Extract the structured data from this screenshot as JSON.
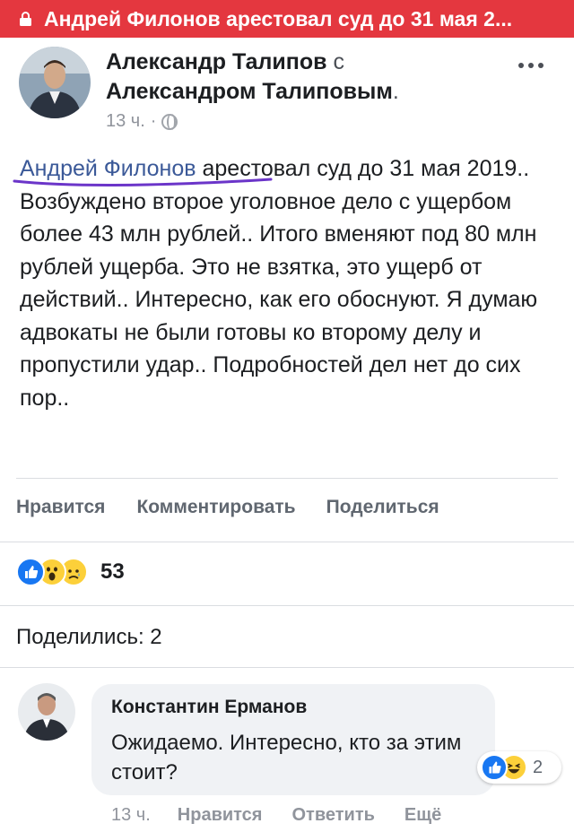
{
  "topbar": {
    "title": "Андрей Филонов арестовал суд до 31 мая 2..."
  },
  "post": {
    "author": "Александр Талипов",
    "with_word": "с",
    "tagged": "Александром Талиповым",
    "time": "13 ч.",
    "meta_dot": "·",
    "mention": "Андрей Филонов",
    "text": " арестовал суд до 31 мая 2019.. Возбуждено второе уголовное дело с ущербом более 43 млн рублей.. Итого вменяют под 80 млн рублей ущерба. Это не взятка, это ущерб от действий.. Интересно, как его обоснуют. Я думаю адвокаты не были готовы ко второму делу и пропустили удар.. Подробностей дел нет до сих пор.."
  },
  "actions": {
    "like": "Нравится",
    "comment": "Комментировать",
    "share": "Поделиться"
  },
  "reactions": {
    "count": "53"
  },
  "shares": "Поделились: 2",
  "comment": {
    "author": "Константин Ерманов",
    "text": "Ожидаемо. Интересно, кто за этим стоит?",
    "reaction_count": "2",
    "time": "13 ч.",
    "like": "Нравится",
    "reply": "Ответить",
    "more": "Ещё"
  },
  "colors": {
    "topbar": "#e4373f",
    "link": "#3b5998",
    "like_blue": "#1877f2",
    "emoji_yellow": "#fcd03a",
    "hand_drawn_underline": "#6b35c9"
  }
}
